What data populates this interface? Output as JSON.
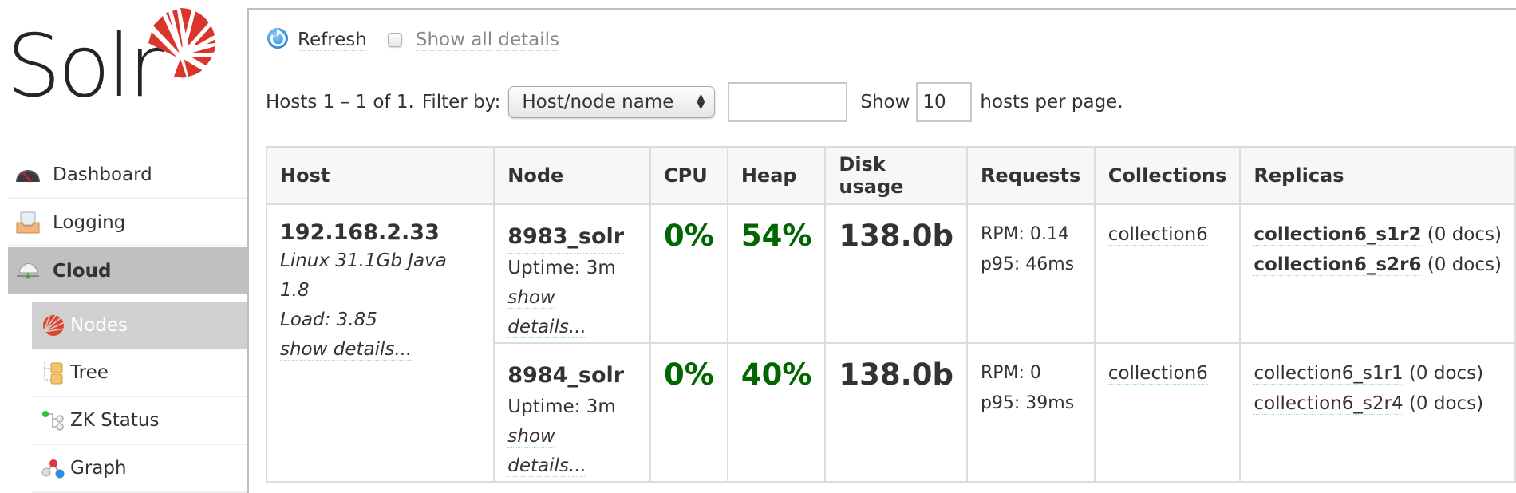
{
  "logo": {
    "text": "Solr",
    "brand_color": "#d9352a"
  },
  "sidebar": {
    "items": [
      {
        "label": "Dashboard",
        "icon": "dashboard-gauge-icon"
      },
      {
        "label": "Logging",
        "icon": "logging-tray-icon"
      },
      {
        "label": "Cloud",
        "icon": "cloud-icon",
        "active": true
      }
    ],
    "sub_items": [
      {
        "label": "Nodes",
        "icon": "solr-sun-icon",
        "active": true
      },
      {
        "label": "Tree",
        "icon": "tree-folders-icon"
      },
      {
        "label": "ZK Status",
        "icon": "zk-status-icon"
      },
      {
        "label": "Graph",
        "icon": "graph-molecule-icon"
      }
    ]
  },
  "toolbar": {
    "refresh_label": "Refresh",
    "show_all_details_label": "Show all details",
    "show_all_details_checked": false
  },
  "filter": {
    "hosts_summary": "Hosts 1 – 1 of 1.",
    "filter_by_label": "Filter by:",
    "filter_by_selected": "Host/node name",
    "filter_value": "",
    "show_label": "Show",
    "per_page_value": "10",
    "per_page_suffix": "hosts per page."
  },
  "table": {
    "columns": [
      "Host",
      "Node",
      "CPU",
      "Heap",
      "Disk usage",
      "Requests",
      "Collections",
      "Replicas"
    ],
    "host": {
      "ip": "192.168.2.33",
      "info": "Linux 31.1Gb Java 1.8",
      "load": "Load: 3.85",
      "details_link": "show details..."
    },
    "nodes": [
      {
        "name": "8983_solr",
        "uptime": "Uptime: 3m",
        "details_link": "show details...",
        "cpu": "0%",
        "heap": "54%",
        "disk": "138.0b",
        "rpm": "RPM: 0.14",
        "p95": "p95: 46ms",
        "collection": "collection6",
        "replicas": [
          {
            "name": "collection6_s1r2",
            "docs": "(0 docs)",
            "bold": true
          },
          {
            "name": "collection6_s2r6",
            "docs": "(0 docs)",
            "bold": true
          }
        ]
      },
      {
        "name": "8984_solr",
        "uptime": "Uptime: 3m",
        "details_link": "show details...",
        "cpu": "0%",
        "heap": "40%",
        "disk": "138.0b",
        "rpm": "RPM: 0",
        "p95": "p95: 39ms",
        "collection": "collection6",
        "replicas": [
          {
            "name": "collection6_s1r1",
            "docs": "(0 docs)",
            "bold": false
          },
          {
            "name": "collection6_s2r4",
            "docs": "(0 docs)",
            "bold": false
          }
        ]
      }
    ],
    "status_color_ok": "#006600"
  }
}
